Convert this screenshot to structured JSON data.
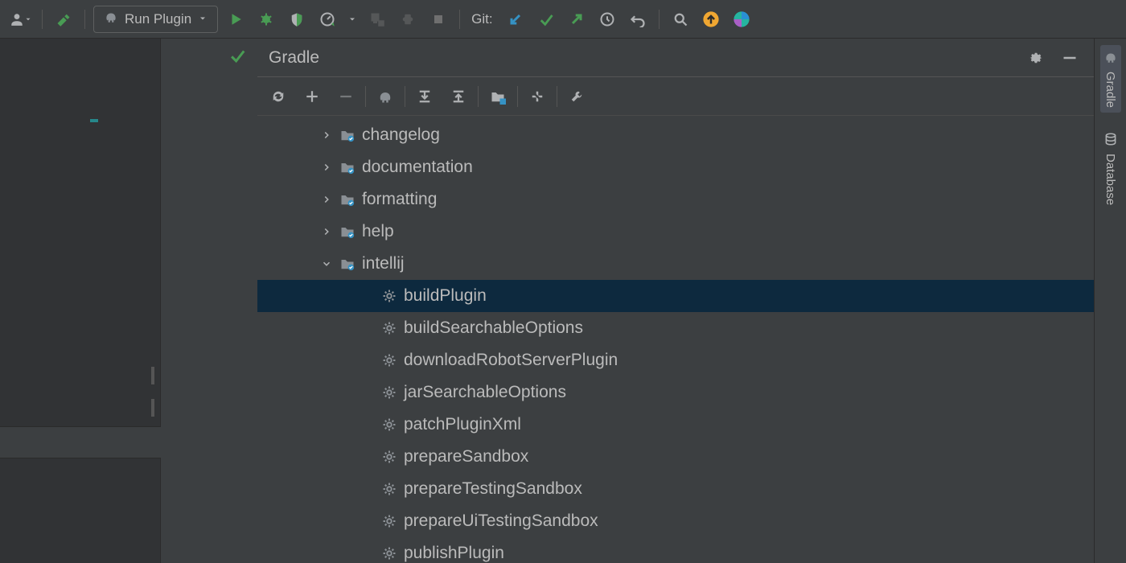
{
  "toolbar": {
    "run_config_label": "Run Plugin",
    "git_label": "Git:"
  },
  "panel": {
    "title": "Gradle"
  },
  "tree": {
    "folders": [
      {
        "label": "changelog",
        "expanded": false
      },
      {
        "label": "documentation",
        "expanded": false
      },
      {
        "label": "formatting",
        "expanded": false
      },
      {
        "label": "help",
        "expanded": false
      },
      {
        "label": "intellij",
        "expanded": true
      }
    ],
    "tasks": [
      {
        "label": "buildPlugin",
        "selected": true
      },
      {
        "label": "buildSearchableOptions",
        "selected": false
      },
      {
        "label": "downloadRobotServerPlugin",
        "selected": false
      },
      {
        "label": "jarSearchableOptions",
        "selected": false
      },
      {
        "label": "patchPluginXml",
        "selected": false
      },
      {
        "label": "prepareSandbox",
        "selected": false
      },
      {
        "label": "prepareTestingSandbox",
        "selected": false
      },
      {
        "label": "prepareUiTestingSandbox",
        "selected": false
      },
      {
        "label": "publishPlugin",
        "selected": false
      }
    ]
  },
  "right_strip": {
    "items": [
      {
        "label": "Gradle",
        "active": true
      },
      {
        "label": "Database",
        "active": false
      }
    ]
  },
  "colors": {
    "green": "#499c54",
    "blue": "#3592c4",
    "orange": "#f0a732",
    "teal": "#26878a",
    "selection": "#0d293e"
  }
}
